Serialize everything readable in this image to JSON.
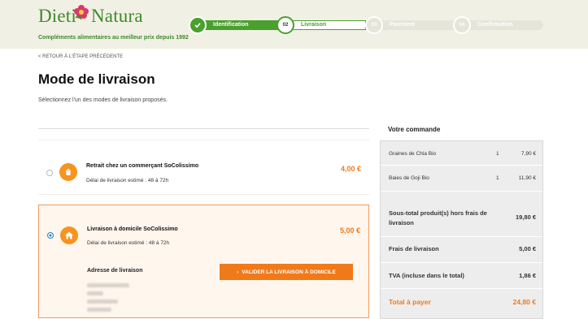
{
  "brand": {
    "name_part1": "Dieti",
    "name_part2": "Natura",
    "tagline": "Compléments alimentaires au meilleur prix depuis 1992"
  },
  "steps": [
    {
      "number": "",
      "label": "Identification",
      "state": "done"
    },
    {
      "number": "02",
      "label": "Livraison",
      "state": "current"
    },
    {
      "number": "03",
      "label": "Paiement",
      "state": "upcoming"
    },
    {
      "number": "04",
      "label": "Confirmation",
      "state": "upcoming"
    }
  ],
  "back_link": "< RETOUR À L'ÉTAPE PRÉCÉDENTE",
  "page_title": "Mode de livraison",
  "subtitle": "Sélectionnez l'un des modes de livraison proposés.",
  "options": [
    {
      "title": "Retrait chez un commerçant SoColissimo",
      "delay": "Délai de livraison estimé : 48 à 72h",
      "price": "4,00 €",
      "selected": false,
      "icon": "shopping-bag-icon"
    },
    {
      "title": "Livraison à domicile SoColissimo",
      "delay": "Délai de livraison estimé : 48 à 72h",
      "price": "5,00 €",
      "selected": true,
      "icon": "home-icon"
    }
  ],
  "address": {
    "title": "Adresse de livraison",
    "validate_label": "VALIDER LA LIVRAISON À DOMICILE"
  },
  "summary": {
    "title": "Votre commande",
    "items": [
      {
        "name": "Graines de Chia Bio",
        "qty": "1",
        "price": "7,90 €"
      },
      {
        "name": "Baies de Goji Bio",
        "qty": "1",
        "price": "11,90 €"
      }
    ],
    "subtotal_label": "Sous-total produit(s) hors frais de livraison",
    "subtotal_value": "19,80 €",
    "shipping_label": "Frais de livraison",
    "shipping_value": "5,00 €",
    "tax_label": "TVA (incluse dans le total)",
    "tax_value": "1,86 €",
    "total_label": "Total à payer",
    "total_value": "24,80 €"
  },
  "colors": {
    "green": "#4aa02c",
    "orange": "#f07a1a",
    "blue": "#2e86c1"
  }
}
